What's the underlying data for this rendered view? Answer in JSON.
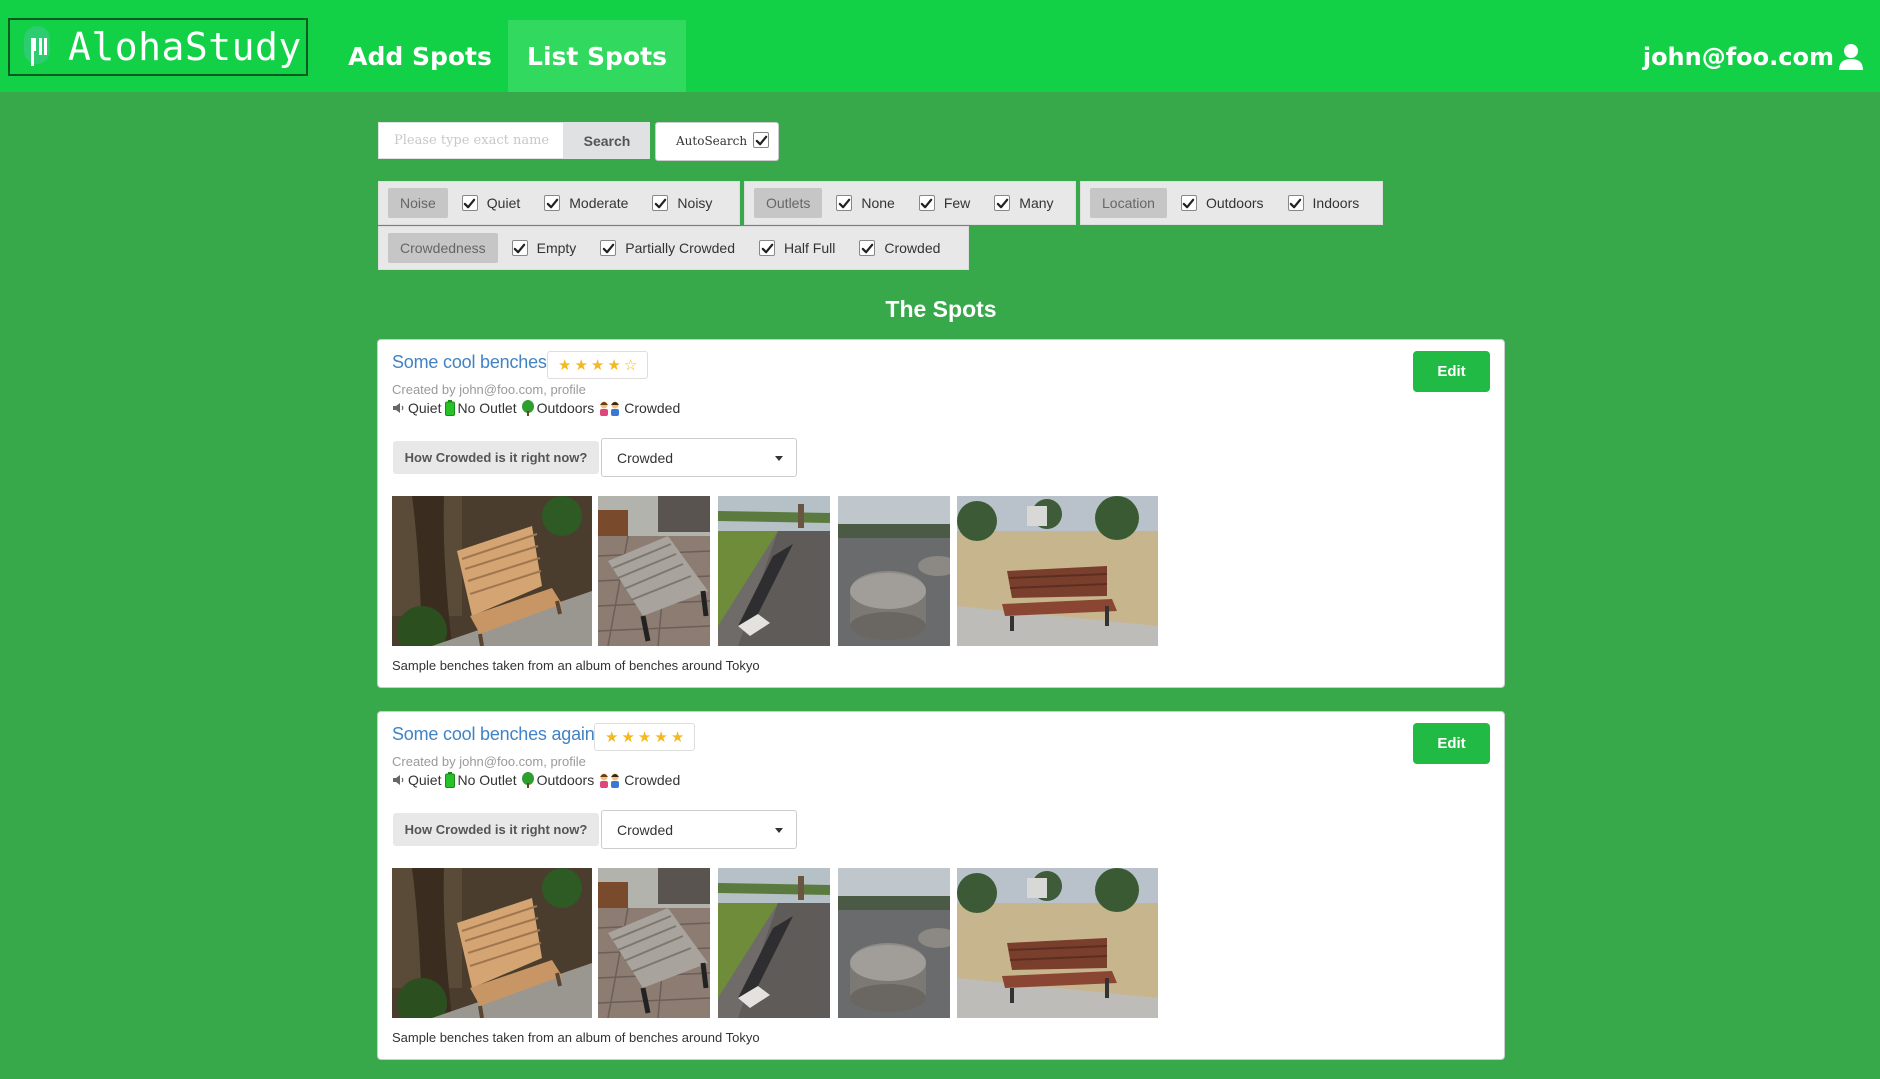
{
  "nav": {
    "brand": "AlohaStudy",
    "links": [
      {
        "label": "Add Spots",
        "active": false
      },
      {
        "label": "List Spots",
        "active": true
      }
    ],
    "user": "john@foo.com",
    "colors": {
      "navbar": "#12d146",
      "active_link": "#32d95f",
      "page_bg": "#38a94b"
    }
  },
  "search": {
    "placeholder": "Please type exact name",
    "value": "",
    "button_label": "Search",
    "autosearch_label": "AutoSearch",
    "autosearch_checked": true
  },
  "filters": {
    "noise": {
      "label": "Noise",
      "options": [
        {
          "label": "Quiet",
          "checked": true
        },
        {
          "label": "Moderate",
          "checked": true
        },
        {
          "label": "Noisy",
          "checked": true
        }
      ]
    },
    "outlets": {
      "label": "Outlets",
      "options": [
        {
          "label": "None",
          "checked": true
        },
        {
          "label": "Few",
          "checked": true
        },
        {
          "label": "Many",
          "checked": true
        }
      ]
    },
    "location": {
      "label": "Location",
      "options": [
        {
          "label": "Outdoors",
          "checked": true
        },
        {
          "label": "Indoors",
          "checked": true
        }
      ]
    },
    "crowdedness": {
      "label": "Crowdedness",
      "options": [
        {
          "label": "Empty",
          "checked": true
        },
        {
          "label": "Partially Crowded",
          "checked": true
        },
        {
          "label": "Half Full",
          "checked": true
        },
        {
          "label": "Crowded",
          "checked": true
        }
      ]
    }
  },
  "section_title": "The Spots",
  "spots": [
    {
      "title": "Some cool benches",
      "rating": 4,
      "max_rating": 5,
      "created_by": "Created by john@foo.com, profile",
      "tags": {
        "noise": "Quiet",
        "outlet": "No Outlet",
        "location": "Outdoors",
        "crowd": "Crowded"
      },
      "question": "How Crowded is it right now?",
      "crowd_value": "Crowded",
      "edit_label": "Edit",
      "photos": [
        "bench-wooden-gravel",
        "bench-slatted-sidewalk",
        "bench-concrete-path",
        "stone-stools",
        "bench-brown-park"
      ],
      "caption": "Sample benches taken from an album of benches around Tokyo"
    },
    {
      "title": "Some cool benches again",
      "rating": 5,
      "max_rating": 5,
      "created_by": "Created by john@foo.com, profile",
      "tags": {
        "noise": "Quiet",
        "outlet": "No Outlet",
        "location": "Outdoors",
        "crowd": "Crowded"
      },
      "question": "How Crowded is it right now?",
      "crowd_value": "Crowded",
      "edit_label": "Edit",
      "photos": [
        "bench-wooden-gravel",
        "bench-slatted-sidewalk",
        "bench-concrete-path",
        "stone-stools",
        "bench-brown-park"
      ],
      "caption": "Sample benches taken from an album of benches around Tokyo"
    }
  ]
}
